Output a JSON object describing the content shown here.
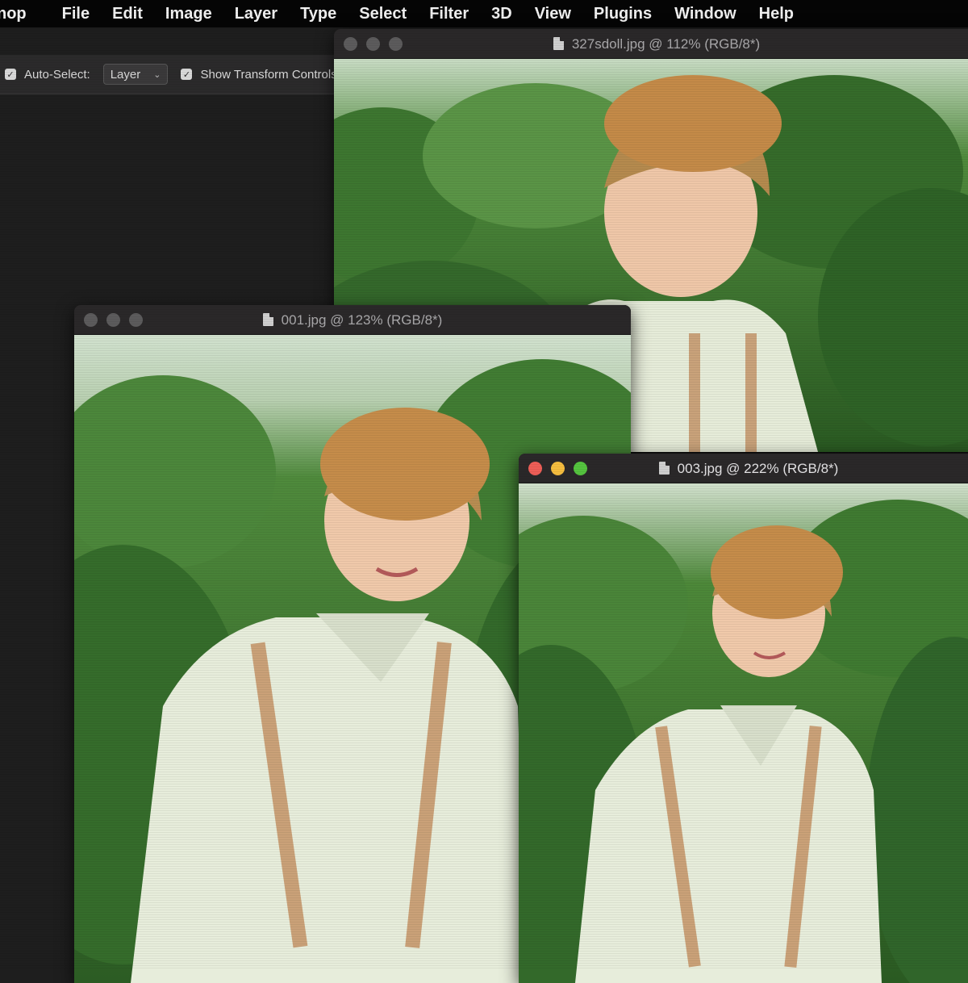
{
  "menubar": {
    "app_fragment": "nop",
    "items": [
      "File",
      "Edit",
      "Image",
      "Layer",
      "Type",
      "Select",
      "Filter",
      "3D",
      "View",
      "Plugins",
      "Window",
      "Help"
    ]
  },
  "options_bar": {
    "auto_select_label": "Auto-Select:",
    "auto_select_value": "Layer",
    "show_transform_label": "Show Transform Controls"
  },
  "windows": [
    {
      "title": "327sdoll.jpg @ 112% (RGB/8*)",
      "active": false
    },
    {
      "title": "001.jpg @ 123% (RGB/8*)",
      "active": false
    },
    {
      "title": "003.jpg @ 222% (RGB/8*)",
      "active": true
    }
  ],
  "colors": {
    "menubar_bg": "#050505",
    "panel_bg": "#2b2a2b",
    "close_red": "#ee5e57",
    "minimize_yellow": "#f5bd3f",
    "zoom_green": "#55c43f"
  }
}
